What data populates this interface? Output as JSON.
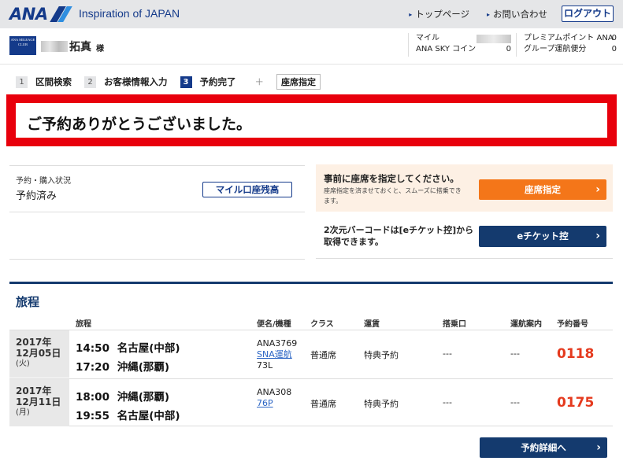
{
  "header": {
    "logo_text": "ANA",
    "tagline": "Inspiration of JAPAN",
    "links": [
      "トップページ",
      "お問い合わせ"
    ],
    "logout_label": "ログアウト",
    "brand_color": "#143a8a"
  },
  "user": {
    "club_badge": "ANA MILEAGE CLUB",
    "name": "拓真",
    "honorific": "様",
    "miles_label": "マイル",
    "sky_coin_label": "ANA SKY コイン",
    "sky_coin_value": "0",
    "premium_points_label": "プレミアムポイント",
    "premium_points_value": "0",
    "group_flights_label": "ANAグループ運航便分",
    "group_flights_value": "0"
  },
  "steps": [
    {
      "num": "1",
      "label": "区間検索"
    },
    {
      "num": "2",
      "label": "お客様情報入力"
    },
    {
      "num": "3",
      "label": "予約完了"
    }
  ],
  "steps_plus": "＋",
  "steps_seat": "座席指定",
  "banner": {
    "message": "ご予約ありがとうございました。",
    "border_color": "#e8000c"
  },
  "status": {
    "label": "予約・購入状況",
    "value": "予約済み",
    "mile_button": "マイル口座残高"
  },
  "seat_panel": {
    "title": "事前に座席を指定してください。",
    "subtitle": "座席指定を済ませておくと、スムーズに搭乗できます。",
    "button": "座席指定",
    "button_color": "#f47619"
  },
  "eticket_panel": {
    "text": "2次元バーコードは[eチケット控]から取得できます。",
    "button": "eチケット控"
  },
  "itinerary": {
    "title": "旅程",
    "columns": {
      "route": "旅程",
      "flight": "便名/機種",
      "class": "クラス",
      "fare": "運賃",
      "gate": "搭乗口",
      "operation": "運航案内",
      "booking": "予約番号"
    },
    "rows": [
      {
        "year": "2017年",
        "date": "12月05日",
        "dow": "(火)",
        "dep_time": "14:50",
        "dep_airport": "名古屋(中部)",
        "arr_time": "17:20",
        "arr_airport": "沖縄(那覇)",
        "flight_no": "ANA3769",
        "operator": "SNA運航",
        "aircraft": "73L",
        "class": "普通席",
        "fare": "特典予約",
        "gate": "---",
        "operation": "---",
        "booking": "0118"
      },
      {
        "year": "2017年",
        "date": "12月11日",
        "dow": "(月)",
        "dep_time": "18:00",
        "dep_airport": "沖縄(那覇)",
        "arr_time": "19:55",
        "arr_airport": "名古屋(中部)",
        "flight_no": "ANA308",
        "operator": "",
        "aircraft": "76P",
        "class": "普通席",
        "fare": "特典予約",
        "gate": "---",
        "operation": "---",
        "booking": "0175"
      }
    ]
  },
  "detail_button": "予約詳細へ"
}
